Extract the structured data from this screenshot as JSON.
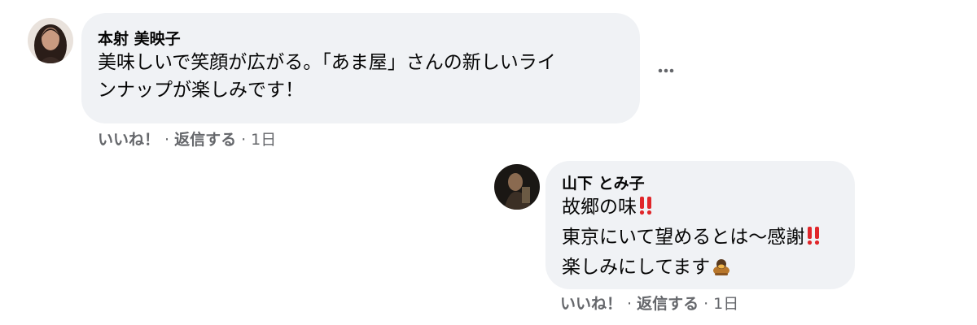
{
  "comments": [
    {
      "author": "本射 美映子",
      "lines": [
        "美味しいで笑顔が広がる。「あま屋」さんの新しいライ",
        "ンナップが楽しみです！"
      ],
      "like_label": "いいね！",
      "reply_label": "返信する",
      "time": "1日",
      "separator": "·"
    },
    {
      "author": "山下 とみ子",
      "lines": [
        "故郷の味",
        "東京にいて望めるとは～感謝",
        "楽しみにしてます"
      ],
      "like_label": "いいね！",
      "reply_label": "返信する",
      "time": "1日",
      "separator": "·"
    }
  ],
  "icons": {
    "more": "ellipsis-horizontal-icon",
    "double_exclamation": "double-exclamation-emoji",
    "bowing": "bowing-person-emoji"
  },
  "colors": {
    "bubble": "#f0f2f5",
    "meta_text": "#65676b",
    "emoji_red": "#e0262a",
    "emoji_brown": "#b8762a"
  }
}
